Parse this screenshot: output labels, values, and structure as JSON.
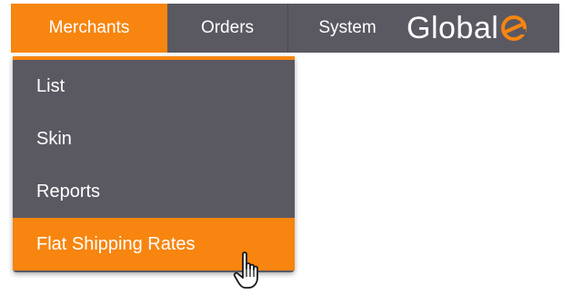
{
  "navbar": {
    "items": [
      {
        "label": "Merchants",
        "active": true
      },
      {
        "label": "Orders",
        "active": false
      },
      {
        "label": "System",
        "active": false
      }
    ],
    "logo": {
      "text": "Global",
      "mark": "e"
    }
  },
  "dropdown": {
    "items": [
      {
        "label": "List"
      },
      {
        "label": "Skin"
      },
      {
        "label": "Reports"
      },
      {
        "label": "Flat Shipping Rates",
        "active": true
      }
    ]
  },
  "colors": {
    "accent": "#f7850f",
    "nav_bg": "#5a5962",
    "text": "#ffffff"
  },
  "cursor": {
    "icon": "hand-pointer-icon"
  }
}
